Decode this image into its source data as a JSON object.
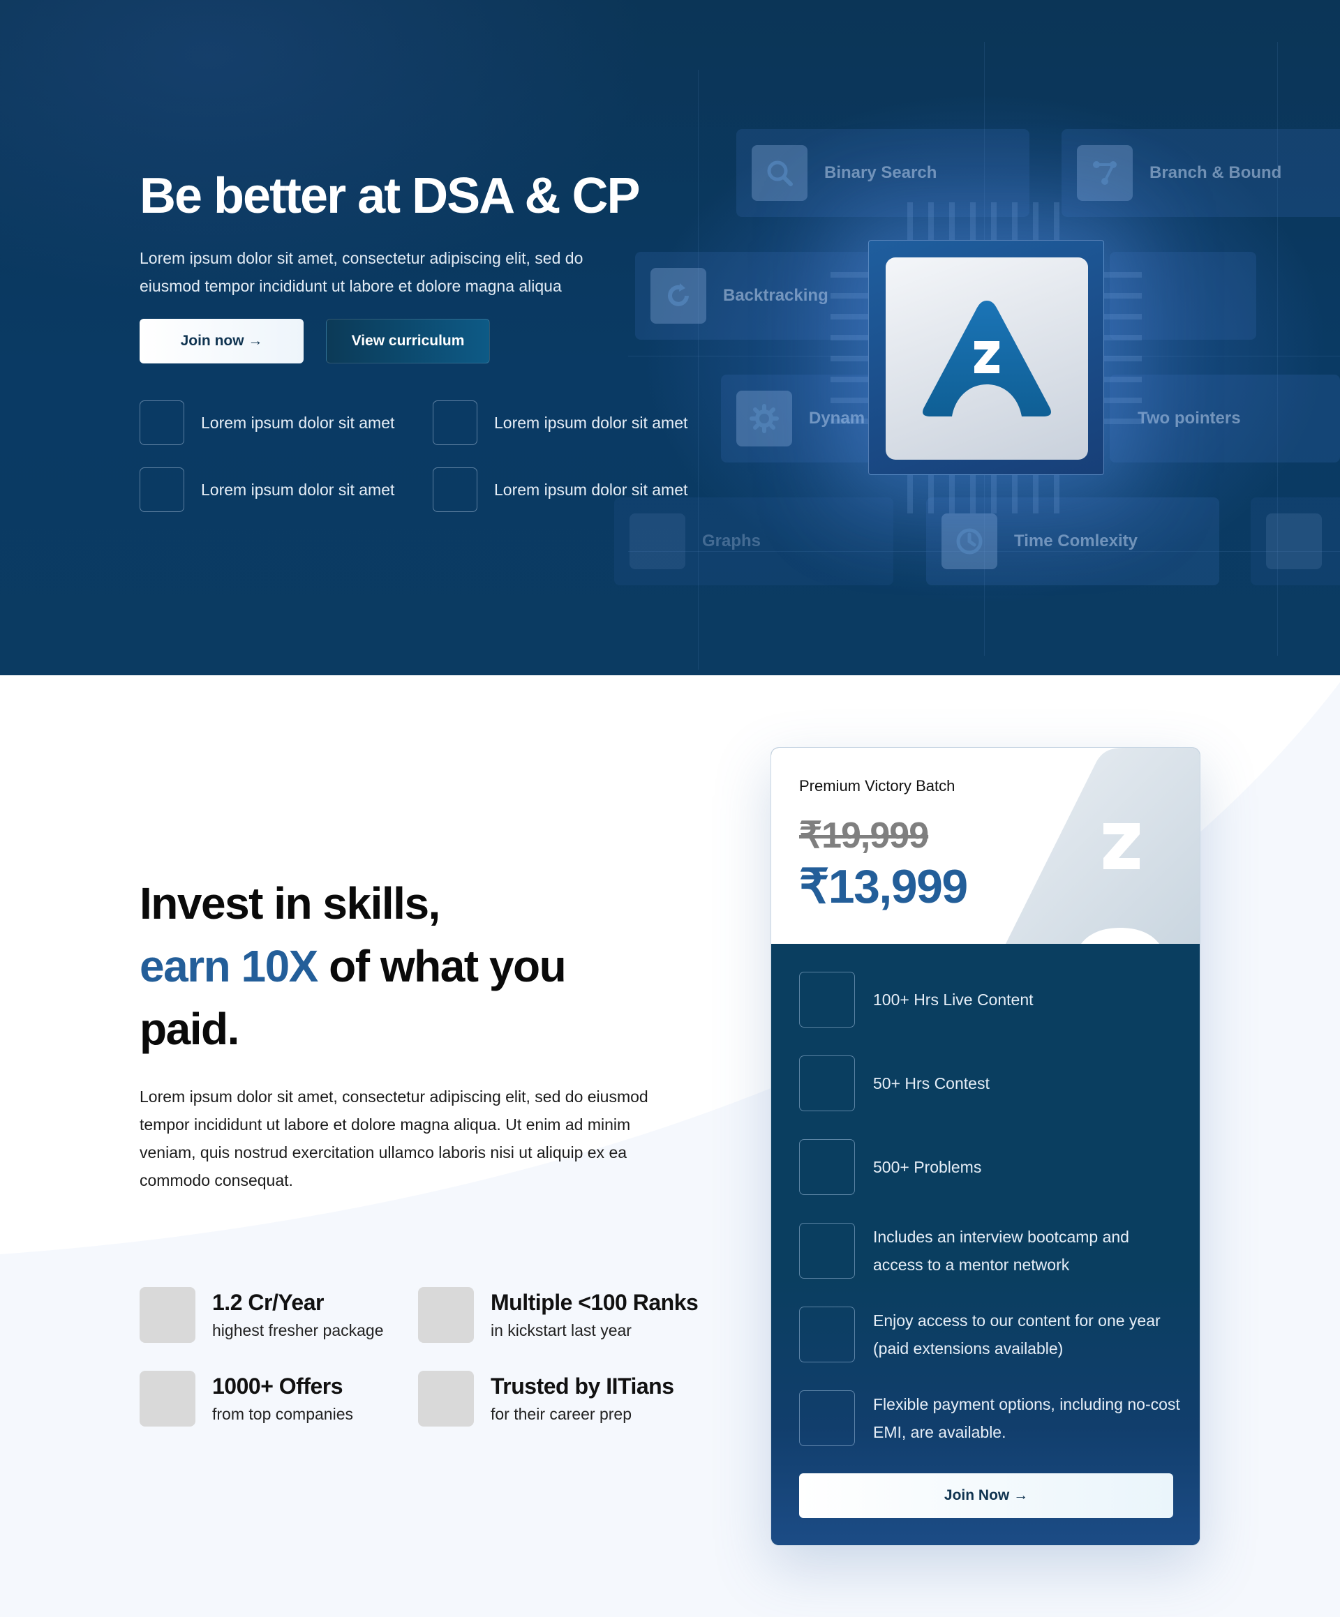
{
  "hero": {
    "title": "Be better at DSA & CP",
    "subtitle": "Lorem ipsum dolor sit amet, consectetur adipiscing elit, sed do eiusmod tempor incididunt ut labore et dolore magna aliqua",
    "join_label": "Join now →",
    "curriculum_label": "View curriculum",
    "features": [
      "Lorem ipsum dolor sit amet",
      "Lorem ipsum dolor sit amet",
      "Lorem ipsum dolor sit amet",
      "Lorem ipsum dolor sit amet"
    ],
    "tiles": {
      "binary_search": "Binary Search",
      "branch_bound": "Branch & Bound",
      "backtracking": "Backtracking",
      "dynamic": "Dynam",
      "two_pointers": "Two pointers",
      "graphs": "Graphs",
      "time_complexity": "Time Comlexity"
    }
  },
  "invest": {
    "title_line1": "Invest in skills,",
    "title_accent": "earn 10X",
    "title_rest": " of what you",
    "title_line3": "paid.",
    "body": "Lorem ipsum dolor sit amet, consectetur adipiscing elit, sed do eiusmod tempor incididunt ut labore et dolore magna aliqua. Ut enim ad minim veniam, quis nostrud exercitation ullamco laboris nisi ut aliquip ex ea commodo consequat.",
    "stats": [
      {
        "big": "1.2 Cr/Year",
        "small": "highest fresher package"
      },
      {
        "big": "Multiple <100 Ranks",
        "small": "in kickstart last year"
      },
      {
        "big": "1000+ Offers",
        "small": "from top companies"
      },
      {
        "big": "Trusted by IITians",
        "small": "for their career prep"
      }
    ]
  },
  "card": {
    "name": "Premium Victory Batch",
    "old_price": "₹19,999",
    "new_price": "₹13,999",
    "features": [
      "100+ Hrs Live Content",
      "50+ Hrs Contest",
      "500+ Problems",
      "Includes an interview bootcamp and access to a mentor network",
      "Enjoy access to our content for one year (paid extensions available)",
      "Flexible payment options, including no-cost EMI, are available."
    ],
    "join_label": "Join Now →"
  },
  "colors": {
    "hero_bg": "#0a3a64",
    "accent": "#235e99",
    "card_bg": "#0b3e60"
  }
}
